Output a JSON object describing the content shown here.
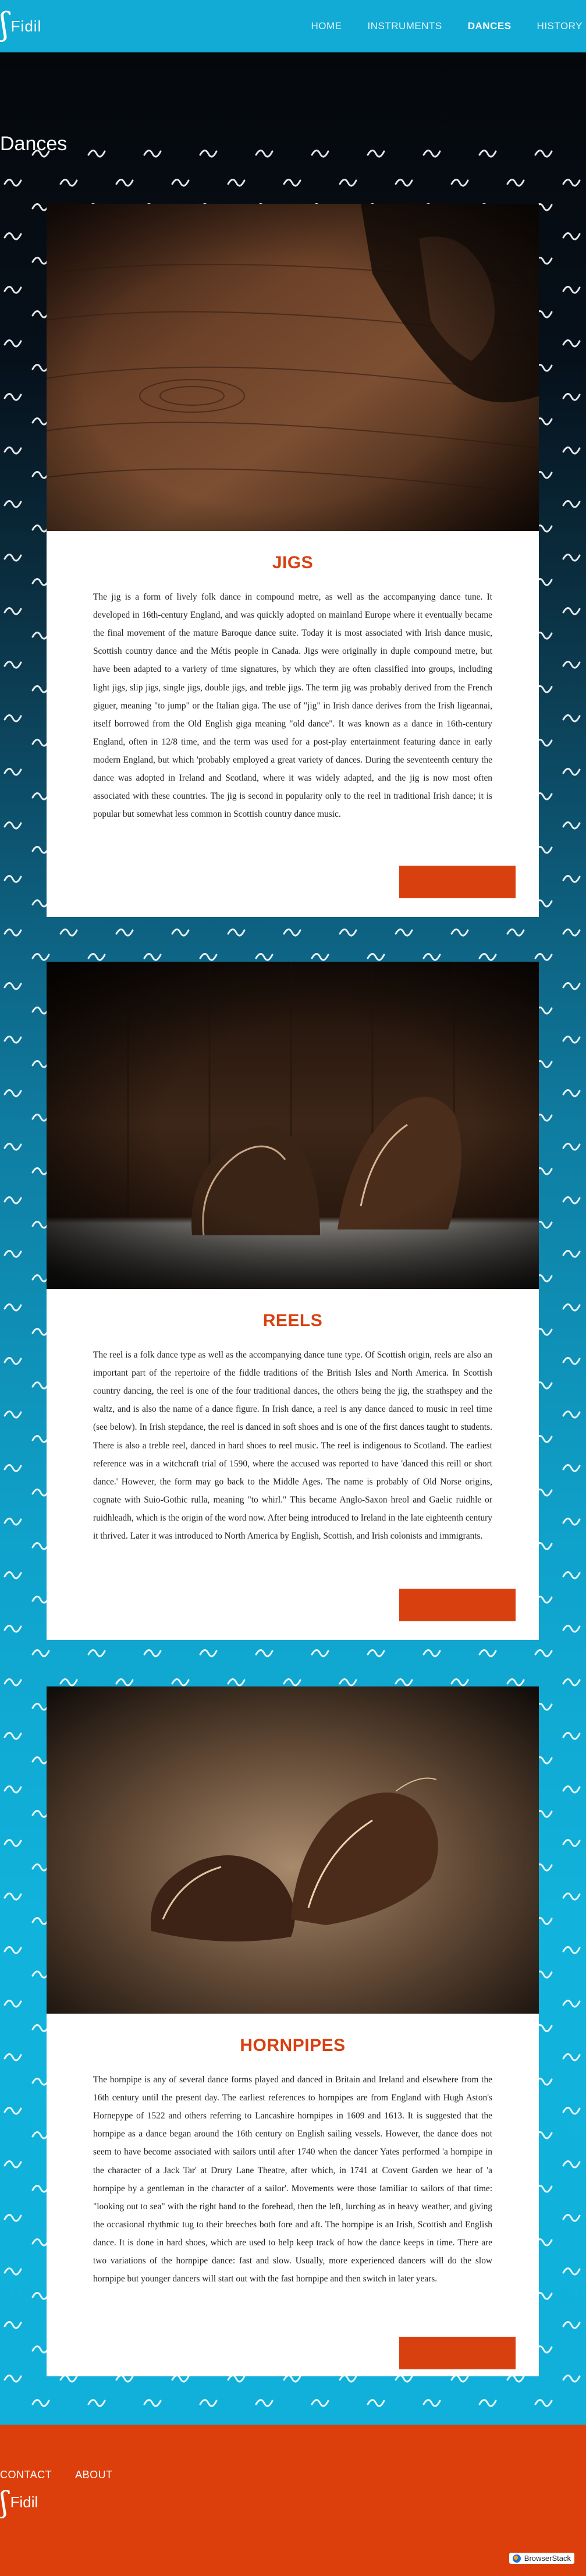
{
  "brand": {
    "name": "Fidil",
    "mark": "ʃ"
  },
  "nav": {
    "items": [
      {
        "label": "HOME"
      },
      {
        "label": "INSTRUMENTS"
      },
      {
        "label": "DANCES"
      },
      {
        "label": "HISTORY"
      }
    ],
    "active": "DANCES"
  },
  "page": {
    "title": "Dances"
  },
  "sections": [
    {
      "title": "JIGS",
      "text": "The jig is a form of lively folk dance in compound metre, as well as the accompanying dance tune. It developed in 16th-century England, and was quickly adopted on mainland Europe where it eventually became the final movement of the mature Baroque dance suite. Today it is most associated with Irish dance music, Scottish country dance and the Métis people in Canada. Jigs were originally in duple compound metre, but have been adapted to a variety of time signatures, by which they are often classified into groups, including light jigs, slip jigs, single jigs, double jigs, and treble jigs. The term jig was probably derived from the French giguer, meaning \"to jump\" or the Italian giga. The use of \"jig\" in Irish dance derives from the Irish ligeannai, itself borrowed from the Old English giga meaning \"old dance\". It was known as a dance in 16th-century England, often in 12/8 time, and the term was used for a post-play entertainment featuring dance in early modern England, but which 'probably employed a great variety of dances. During the seventeenth century the dance was adopted in Ireland and Scotland, where it was widely adapted, and the jig is now most often associated with these countries. The jig is second in popularity only to the reel in traditional Irish dance; it is popular but somewhat less common in Scottish country dance music."
    },
    {
      "title": "REELS",
      "text": "The reel is a folk dance type as well as the accompanying dance tune type. Of Scottish origin, reels are also an important part of the repertoire of the fiddle traditions of the British Isles and North America. In Scottish country dancing, the reel is one of the four traditional dances, the others being the jig, the strathspey and the waltz, and is also the name of a dance figure. In Irish dance, a reel is any dance danced to music in reel time (see below). In Irish stepdance, the reel is danced in soft shoes and is one of the first dances taught to students. There is also a treble reel, danced in hard shoes to reel music. The reel is indigenous to Scotland. The earliest reference was in a witchcraft trial of 1590, where the accused was reported to have 'danced this reill or short dance.' However, the form may go back to the Middle Ages. The name is probably of Old Norse origins, cognate with Suio-Gothic rulla, meaning \"to whirl.\" This became Anglo-Saxon hreol and Gaelic ruidhle or ruidhleadh, which is the origin of the word now. After being introduced to Ireland in the late eighteenth century it thrived. Later it was introduced to North America by English, Scottish, and Irish colonists and immigrants."
    },
    {
      "title": "HORNPIPES",
      "text": "The hornpipe is any of several dance forms played and danced in Britain and Ireland and elsewhere from the 16th century until the present day. The earliest references to hornpipes are from England with Hugh Aston's Hornepype of 1522 and others referring to Lancashire hornpipes in 1609 and 1613. It is suggested that the hornpipe as a dance began around the 16th century on English sailing vessels. However, the dance does not seem to have become associated with sailors until after 1740 when the dancer Yates performed 'a hornpipe in the character of a Jack Tar' at Drury Lane Theatre, after which, in 1741 at Covent Garden we hear of 'a hornpipe by a gentleman in the character of a sailor'. Movements were those familiar to sailors of that time: \"looking out to sea\" with the right hand to the forehead, then the left, lurching as in heavy weather, and giving the occasional rhythmic tug to their breeches both fore and aft. The hornpipe is an Irish, Scottish and English dance. It is done in hard shoes, which are used to help keep track of how the dance keeps in time. There are two variations of the hornpipe dance: fast and slow. Usually, more experienced dancers will do the slow hornpipe but younger dancers will start out with the fast hornpipe and then switch in later years."
    }
  ],
  "footer": {
    "links": [
      {
        "label": "CONTACT"
      },
      {
        "label": "ABOUT"
      }
    ],
    "brand": "Fidil"
  },
  "badge": {
    "label": "BrowserStack"
  },
  "colors": {
    "header": "#12abd6",
    "accent": "#d9400f",
    "footer": "#dd3f0c"
  }
}
